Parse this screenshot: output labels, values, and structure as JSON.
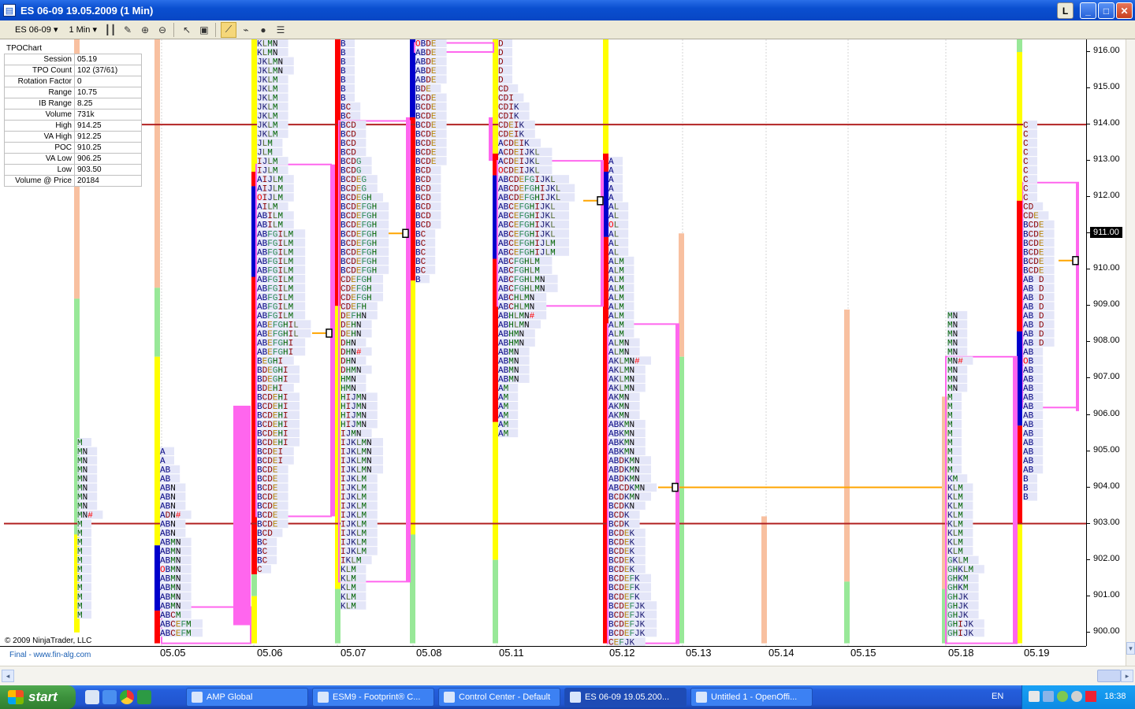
{
  "window": {
    "title": "ES 06-09  19.05.2009 (1 Min)",
    "app_icon": "chart-icon",
    "buttons": [
      "L",
      "_",
      "□",
      "✕"
    ]
  },
  "toolbar": {
    "instrument": "ES 06-09",
    "interval": "1 Min",
    "icons": [
      "bar-type-icon",
      "draw-pencil-icon",
      "zoom-in-icon",
      "zoom-out-icon",
      "cursor-icon",
      "properties-icon",
      "tpo-icon",
      "indicators-icon",
      "strategy-icon",
      "data-box-icon"
    ]
  },
  "info_panel": {
    "title": "TPOChart",
    "rows": [
      {
        "k": "Session",
        "v": "05.19"
      },
      {
        "k": "TPO Count",
        "v": "102 (37/61)"
      },
      {
        "k": "Rotation Factor",
        "v": "0"
      },
      {
        "k": "Range",
        "v": "10.75"
      },
      {
        "k": "IB Range",
        "v": "8.25"
      },
      {
        "k": "Volume",
        "v": "731k"
      },
      {
        "k": "High",
        "v": "914.25"
      },
      {
        "k": "VA High",
        "v": "912.25"
      },
      {
        "k": "POC",
        "v": "910.25"
      },
      {
        "k": "VA Low",
        "v": "906.25"
      },
      {
        "k": "Low",
        "v": "903.50"
      },
      {
        "k": "Volume @ Price",
        "v": "20184"
      }
    ]
  },
  "price_axis": {
    "ticks": [
      "916.00",
      "915.00",
      "914.00",
      "913.00",
      "912.00",
      "911.00",
      "910.00",
      "909.00",
      "908.00",
      "907.00",
      "906.00",
      "905.00",
      "904.00",
      "903.00",
      "902.00",
      "901.00",
      "900.00"
    ],
    "last_price": "911.00"
  },
  "ref_lines": [
    {
      "price": 914.0,
      "color": "#b22222"
    },
    {
      "price": 903.0,
      "color": "#b22222"
    }
  ],
  "sessions": [
    {
      "date": "05.05",
      "tpos": [
        "M",
        "MN",
        "MN",
        "MN",
        "MN",
        "MN",
        "MN",
        "MN",
        "MN#",
        "M",
        "M",
        "M",
        "M",
        "M",
        "M",
        "M",
        "M",
        "M",
        "M",
        "M"
      ]
    },
    {
      "date": "05.06",
      "tpos": [
        "A",
        "A",
        "AB",
        "AB",
        "ABN",
        "ABN",
        "ABN",
        "ADN#",
        "ABN",
        "ABN",
        "ABMN",
        "ABMN",
        "ABMN",
        "OBMN",
        "ABMN",
        "ABMN",
        "ABMN",
        "ABMN",
        "ABCM",
        "ABCEFM",
        "ABCEFM"
      ]
    },
    {
      "date": "05.07",
      "tpos": [
        "KLMN",
        "KLMN",
        "JKLMN",
        "JKLMN",
        "JKLM",
        "JKLM",
        "JKLM",
        "JKLM",
        "JKLM",
        "JKLM",
        "JKLM",
        "JLM",
        "JLM",
        "IJLM",
        "IJLM",
        "AIJLM",
        "AIJLM",
        "OIJLM",
        "AILM",
        "ABILM",
        "ABILM",
        "ABFGILM",
        "ABFGILM",
        "ABFGILM",
        "ABFGILM",
        "ABFGILM",
        "ABFGILM",
        "ABFGILM",
        "ABFGILM",
        "ABFGILM",
        "ABFGILM",
        "ABEFGHIL",
        "ABEFGHIL",
        "ABEFGHI",
        "ABEFGHI",
        "BEGHI",
        "BDEGHI",
        "BDEGHI",
        "BDEHI",
        "BCDEHI",
        "BCDEHI",
        "BCDEHI",
        "BCDEHI",
        "BCDEHI",
        "BCDEHI",
        "BCDEI",
        "BCDEI",
        "BCDE",
        "BCDE",
        "BCDE",
        "BCDE",
        "BCDE",
        "BCDE",
        "BCDE",
        "BCD",
        "BC",
        "BC",
        "BC",
        "C"
      ]
    },
    {
      "date": "05.08",
      "tpos": [
        "B",
        "B",
        "B",
        "B",
        "B",
        "B",
        "B",
        "BC",
        "BC",
        "BCD",
        "BCD",
        "BCD",
        "BCD",
        "BCDG",
        "BCDG",
        "BCDEG",
        "BCDEG",
        "BCDEGH",
        "BCDEFGH",
        "BCDEFGH",
        "BCDEFGH",
        "BCDEFGH",
        "BCDEFGH",
        "BCDEFGH",
        "BCDEFGH",
        "BCDEFGH",
        "CDEFGH",
        "CDEFGH",
        "CDEFGH",
        "CDEFH",
        "DEFHN",
        "DEHN",
        "DEHN",
        "DHN",
        "DHN#",
        "DHN",
        "DHMN",
        "HMN",
        "HMN",
        "HIJMN",
        "HIJMN",
        "HIJMN",
        "HIJMN",
        "IJMN",
        "IJKLMN",
        "IJKLMN",
        "IJKLMN",
        "IJKLMN",
        "IJKLM",
        "IJKLM",
        "IJKLM",
        "IJKLM",
        "IJKLM",
        "IJKLM",
        "IJKLM",
        "IJKLM",
        "IJKLM",
        "IKLM",
        "KLM",
        "KLM",
        "KLM",
        "KLM",
        "KLM"
      ]
    },
    {
      "date": "05.11",
      "tpos": [
        "OBDE",
        "ABDE",
        "ABDE",
        "ABDE",
        "ABDE",
        "BDE",
        "BCDE",
        "BCDE",
        "BCDE",
        "BCDE",
        "BCDE",
        "BCDE",
        "BCDE",
        "BCDE",
        "BCD",
        "BCD",
        "BCD",
        "BCD",
        "BCD",
        "BCD",
        "BCD",
        "BC",
        "BC",
        "BC",
        "BC",
        "BC",
        "B"
      ]
    },
    {
      "date": "05.12",
      "tpos": [
        "D",
        "D",
        "D",
        "D",
        "D",
        "CD",
        "CDI",
        "CDIK",
        "CDIK",
        "CDEIK",
        "CDEIK",
        "ACDEIK",
        "ACDEIJKL",
        "ACDEIJKL",
        "OCDEIJKL",
        "ABCDEFGIJKL",
        "ABCDEFGHIJKL",
        "ABCDEFGHIJKL",
        "ABCEFGHIJKL",
        "ABCEFGHIJKL",
        "ABCEFGHIJKL",
        "ABCEFGHIJKL",
        "ABCEFGHIJLM",
        "ABCEFGHIJLM",
        "ABCFGHLM",
        "ABCFGHLM",
        "ABCFGHLMN",
        "ABCFGHLMN",
        "ABCHLMN",
        "ABCHLMN",
        "ABHLMN#",
        "ABHLMN",
        "ABHMN",
        "ABHMN",
        "ABMN",
        "ABMN",
        "ABMN",
        "ABMN",
        "AM",
        "AM",
        "AM",
        "AM",
        "AM",
        "AM"
      ]
    },
    {
      "date": "05.13",
      "tpos": [
        "A",
        "A",
        "A",
        "A",
        "A",
        "AL",
        "AL",
        "OL",
        "AL",
        "AL",
        "AL",
        "ALM",
        "ALM",
        "ALM",
        "ALM",
        "ALM",
        "ALM",
        "ALM",
        "ALM",
        "ALM",
        "ALMN",
        "ALMN",
        "AKLMN#",
        "AKLMN",
        "AKLMN",
        "AKLMN",
        "AKMN",
        "AKMN",
        "AKMN",
        "ABKMN",
        "ABKMN",
        "ABKMN",
        "ABKMN",
        "ABDKMN",
        "ABDKMN",
        "ABDKMN",
        "ABCDKMN",
        "BCDKMN",
        "BCDKN",
        "BCDK",
        "BCDK",
        "BCDEK",
        "BCDEK",
        "BCDEK",
        "BCDEK",
        "BCDEK",
        "BCDEFK",
        "BCDEFK",
        "BCDEFK",
        "BCDEFJK",
        "BCDEFJK",
        "BCDEFJK",
        "BCDEFJK",
        "CEFJK"
      ]
    },
    {
      "date": "05.14",
      "tpos": []
    },
    {
      "date": "05.15",
      "tpos": []
    },
    {
      "date": "05.18",
      "tpos": []
    },
    {
      "date": "05.19",
      "tpos": [
        "MN",
        "MN",
        "MN",
        "MN",
        "MN",
        "MN#",
        "MN",
        "MN",
        "MN",
        "M",
        "M",
        "M",
        "M",
        "M",
        "M",
        "M",
        "M",
        "M",
        "KM",
        "KLM",
        "KLM",
        "KLM",
        "KLM",
        "KLM",
        "KLM",
        "KLM",
        "KLM",
        "GKLM",
        "GHKLM",
        "GHKM",
        "GHKM",
        "GHJK",
        "GHJK",
        "GHJK",
        "GHIJK",
        "GHIJK"
      ]
    },
    {
      "date": "05.20",
      "tpos": [
        "C",
        "C",
        "C",
        "C",
        "C",
        "C",
        "C",
        "C",
        "C",
        "CD",
        "CDE",
        "BCDE",
        "BCDE",
        "BCDE",
        "BCDE",
        "BCDE",
        "BCDE",
        "AB D",
        "AB D",
        "AB D",
        "AB D",
        "AB D",
        "AB D",
        "AB D",
        "AB D",
        "AB",
        "OB",
        "AB",
        "AB",
        "AB",
        "AB",
        "AB",
        "AB",
        "AB",
        "AB",
        "AB",
        "AB",
        "AB",
        "AB",
        "B",
        "B",
        "B"
      ]
    }
  ],
  "date_labels": [
    "05.05",
    "05.06",
    "05.07",
    "05.08",
    "05.11",
    "05.12",
    "05.13",
    "05.14",
    "05.15",
    "05.18",
    "05.19"
  ],
  "copyright": "© 2009 NinjaTrader, LLC",
  "footer_note": "Final - www.fin-alg.com",
  "taskbar": {
    "start": "start",
    "tasks": [
      {
        "label": "AMP Global",
        "active": false
      },
      {
        "label": "ESM9 - Footprint® C...",
        "active": false
      },
      {
        "label": "Control Center - Default",
        "active": false
      },
      {
        "label": "ES 06-09  19.05.200...",
        "active": true
      },
      {
        "label": "Untitled 1 - OpenOffi...",
        "active": false
      }
    ],
    "language": "EN",
    "clock": "18:38"
  },
  "letter_colors": {
    "A": "#000080",
    "B": "#000080",
    "C": "#8b0000",
    "D": "#8b0000",
    "E": "#b8860b",
    "F": "#2e8b57",
    "G": "#2e8b57",
    "H": "#006400",
    "I": "#8b0000",
    "J": "#191970",
    "K": "#191970",
    "L": "#556b2f",
    "M": "#006400",
    "N": "#000000",
    "O": "#ff0000",
    "#": "#ff0000"
  }
}
